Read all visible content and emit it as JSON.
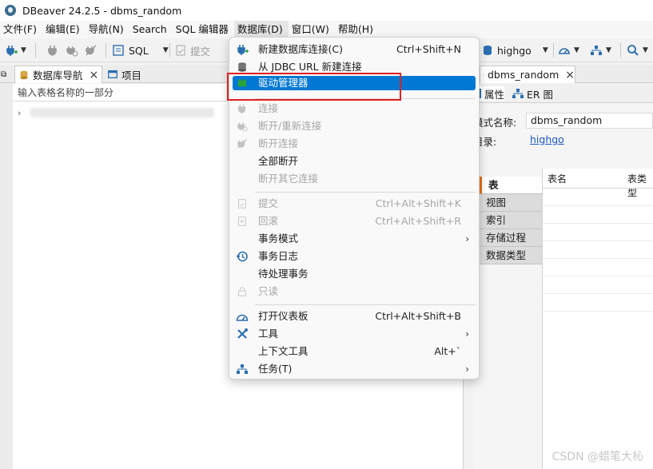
{
  "window": {
    "title": "DBeaver 24.2.5 - dbms_random"
  },
  "menubar": {
    "items": [
      "文件(F)",
      "编辑(E)",
      "导航(N)",
      "Search",
      "SQL 编辑器",
      "数据库(D)",
      "窗口(W)",
      "帮助(H)"
    ]
  },
  "toolbar": {
    "sql_label": "SQL",
    "commit_label": "提交",
    "connection_label": "highgo"
  },
  "left_tabs": {
    "navigator": "数据库导航",
    "project": "项目"
  },
  "left_panel": {
    "filter_placeholder": "输入表格名称的一部分"
  },
  "right_tabs": {
    "editor": "dbms_random"
  },
  "right_panel": {
    "sub_tabs": {
      "properties": "属性",
      "er": "ER 图"
    },
    "schema_label": "模式名称:",
    "schema_value": "dbms_random",
    "catalog_label": "目录:",
    "catalog_value": "highgo",
    "categories": [
      "表",
      "视图",
      "索引",
      "存储过程",
      "数据类型"
    ],
    "grid_headers": [
      "表名",
      "表类型"
    ]
  },
  "database_menu": {
    "items": [
      {
        "label": "新建数据库连接(C)",
        "shortcut": "Ctrl+Shift+N",
        "icon": "plug-plus-icon",
        "disabled": false
      },
      {
        "label": "从 JDBC URL 新建连接",
        "shortcut": "",
        "icon": "database-icon",
        "disabled": false
      },
      {
        "label": "驱动管理器",
        "shortcut": "",
        "icon": "driver-icon",
        "disabled": false,
        "highlight": true
      },
      {
        "label": "连接",
        "shortcut": "",
        "icon": "plug-icon",
        "disabled": true
      },
      {
        "label": "断开/重新连接",
        "shortcut": "",
        "icon": "reconnect-icon",
        "disabled": true
      },
      {
        "label": "断开连接",
        "shortcut": "",
        "icon": "disconnect-icon",
        "disabled": true
      },
      {
        "label": "全部断开",
        "shortcut": "",
        "icon": "",
        "disabled": false
      },
      {
        "label": "断开其它连接",
        "shortcut": "",
        "icon": "",
        "disabled": true
      },
      {
        "label": "提交",
        "shortcut": "Ctrl+Alt+Shift+K",
        "icon": "commit-icon",
        "disabled": true
      },
      {
        "label": "回滚",
        "shortcut": "Ctrl+Alt+Shift+R",
        "icon": "rollback-icon",
        "disabled": true
      },
      {
        "label": "事务模式",
        "shortcut": "",
        "icon": "",
        "disabled": false,
        "submenu": true
      },
      {
        "label": "事务日志",
        "shortcut": "",
        "icon": "history-icon",
        "disabled": false
      },
      {
        "label": "待处理事务",
        "shortcut": "",
        "icon": "",
        "disabled": false
      },
      {
        "label": "只读",
        "shortcut": "",
        "icon": "lock-icon",
        "disabled": true
      },
      {
        "label": "打开仪表板",
        "shortcut": "Ctrl+Alt+Shift+B",
        "icon": "dashboard-icon",
        "disabled": false
      },
      {
        "label": "工具",
        "shortcut": "",
        "icon": "tools-icon",
        "disabled": false,
        "submenu": true
      },
      {
        "label": "上下文工具",
        "shortcut": "Alt+`",
        "icon": "",
        "disabled": false
      },
      {
        "label": "任务(T)",
        "shortcut": "",
        "icon": "tasks-icon",
        "disabled": false,
        "submenu": true
      }
    ]
  },
  "colors": {
    "highlight": "#0078d4",
    "annotation_box": "#e0201f"
  },
  "watermark": "CSDN @蜡笔大杺"
}
